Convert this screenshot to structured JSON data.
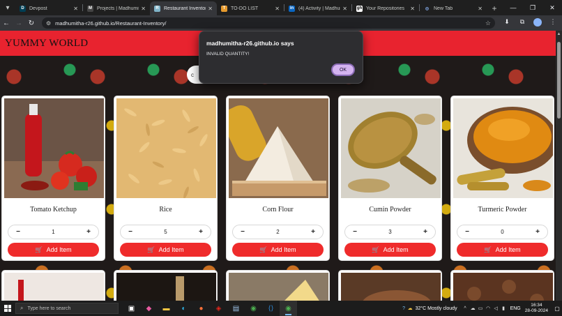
{
  "browser": {
    "tabs": [
      {
        "title": "Devpost",
        "favicon": "D",
        "favicon_color": "#003e54",
        "active": false
      },
      {
        "title": "Projects | Madhumitha",
        "favicon": "M",
        "favicon_color": "#444444",
        "active": false
      },
      {
        "title": "Restaurant Inventory",
        "favicon": "R",
        "favicon_color": "#7fb3c8",
        "active": true
      },
      {
        "title": "TO-DO LIST",
        "favicon": "T",
        "favicon_color": "#e69a2e",
        "active": false
      },
      {
        "title": "(4) Activity | Madhumitha",
        "favicon": "in",
        "favicon_color": "#0a66c2",
        "active": false
      },
      {
        "title": "Your Repositories",
        "favicon": "gh",
        "favicon_color": "#ffffff",
        "active": false
      },
      {
        "title": "New Tab",
        "favicon": "◎",
        "favicon_color": "#8ab4f8",
        "active": false
      }
    ],
    "url": "madhumitha-r26.github.io/Restaurant-Inventory/"
  },
  "page": {
    "brand": "YUMMY WORLD",
    "search_text": "c",
    "add_button_label": "Add Item",
    "items": [
      {
        "name": "Tomato Ketchup",
        "quantity": "1",
        "image": "tomato-ketchup"
      },
      {
        "name": "Rice",
        "quantity": "5",
        "image": "rice"
      },
      {
        "name": "Corn Flour",
        "quantity": "2",
        "image": "corn-flour"
      },
      {
        "name": "Cumin Powder",
        "quantity": "3",
        "image": "cumin-powder"
      },
      {
        "name": "Turmeric Powder",
        "quantity": "0",
        "image": "turmeric-powder"
      }
    ]
  },
  "dialog": {
    "title": "madhumitha-r26.github.io says",
    "message": "INVALID QUANTITY!",
    "ok_label": "OK"
  },
  "taskbar": {
    "search_placeholder": "Type here to search",
    "weather": "32°C  Mostly cloudy",
    "lang": "ENG",
    "time": "16:34",
    "date": "28-09-2024"
  },
  "colors": {
    "header_red": "#e8232f",
    "button_red": "#ef2b2b",
    "ok_button": "#d4b3f0"
  }
}
